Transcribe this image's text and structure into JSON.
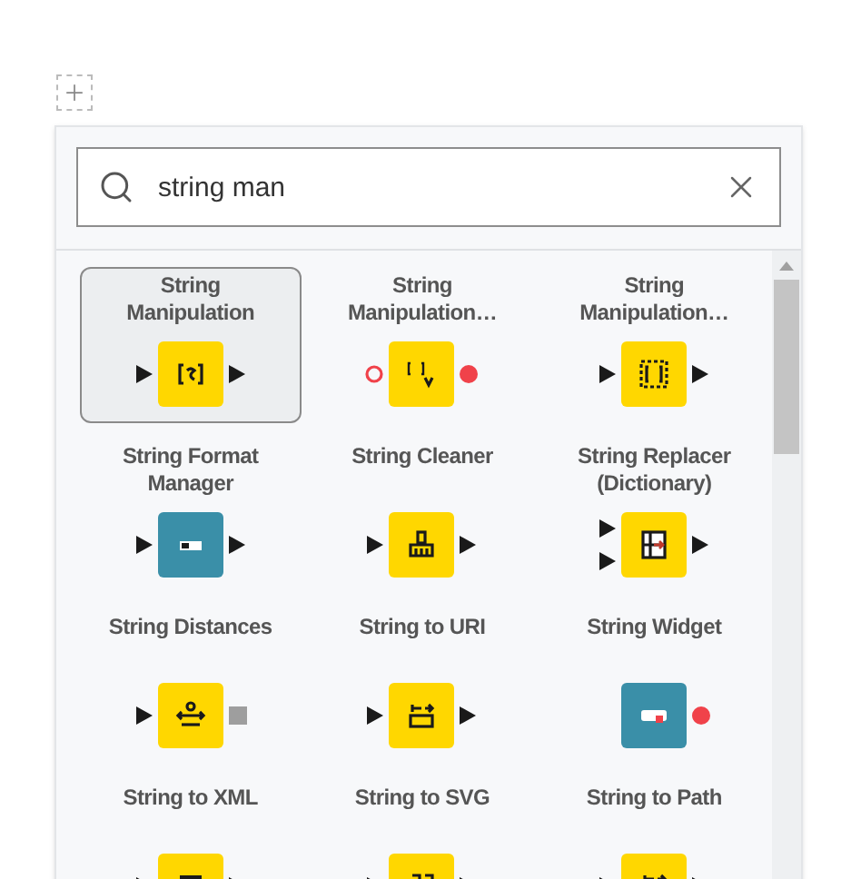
{
  "search": {
    "value": "string man"
  },
  "nodes": [
    {
      "label": "String Manipulation",
      "selected": true,
      "color": "#ffd700",
      "in_ports": [
        {
          "kind": "data"
        }
      ],
      "out_ports": [
        {
          "kind": "data"
        }
      ]
    },
    {
      "label": "String Manipulation…",
      "selected": false,
      "color": "#ffd700",
      "in_ports": [
        {
          "kind": "flow_variable_optional"
        }
      ],
      "out_ports": [
        {
          "kind": "flow_variable"
        }
      ]
    },
    {
      "label": "String Manipulation…",
      "selected": false,
      "color": "#ffd700",
      "in_ports": [
        {
          "kind": "data"
        }
      ],
      "out_ports": [
        {
          "kind": "data"
        }
      ]
    },
    {
      "label": "String Format Manager",
      "selected": false,
      "color": "#3a8fa8",
      "in_ports": [
        {
          "kind": "data"
        }
      ],
      "out_ports": [
        {
          "kind": "data"
        }
      ]
    },
    {
      "label": "String Cleaner",
      "selected": false,
      "color": "#ffd700",
      "in_ports": [
        {
          "kind": "data"
        }
      ],
      "out_ports": [
        {
          "kind": "data"
        }
      ]
    },
    {
      "label": "String Replacer (Dictionary)",
      "selected": false,
      "color": "#ffd700",
      "in_ports": [
        {
          "kind": "data"
        },
        {
          "kind": "data"
        }
      ],
      "out_ports": [
        {
          "kind": "data"
        }
      ]
    },
    {
      "label": "String Distances",
      "selected": false,
      "color": "#ffd700",
      "in_ports": [
        {
          "kind": "data"
        }
      ],
      "out_ports": [
        {
          "kind": "model"
        }
      ]
    },
    {
      "label": "String to URI",
      "selected": false,
      "color": "#ffd700",
      "in_ports": [
        {
          "kind": "data"
        }
      ],
      "out_ports": [
        {
          "kind": "data"
        }
      ]
    },
    {
      "label": "String Widget",
      "selected": false,
      "color": "#3a8fa8",
      "out_ports": [
        {
          "kind": "flow_variable"
        }
      ]
    },
    {
      "label": "String to XML",
      "selected": false,
      "color": "#ffd700",
      "in_ports": [
        {
          "kind": "data"
        }
      ],
      "out_ports": [
        {
          "kind": "data"
        }
      ]
    },
    {
      "label": "String to SVG",
      "selected": false,
      "color": "#ffd700",
      "in_ports": [
        {
          "kind": "data"
        }
      ],
      "out_ports": [
        {
          "kind": "data"
        }
      ]
    },
    {
      "label": "String to Path",
      "selected": false,
      "color": "#ffd700",
      "in_ports": [
        {
          "kind": "data"
        }
      ],
      "out_ports": [
        {
          "kind": "data"
        }
      ]
    }
  ]
}
